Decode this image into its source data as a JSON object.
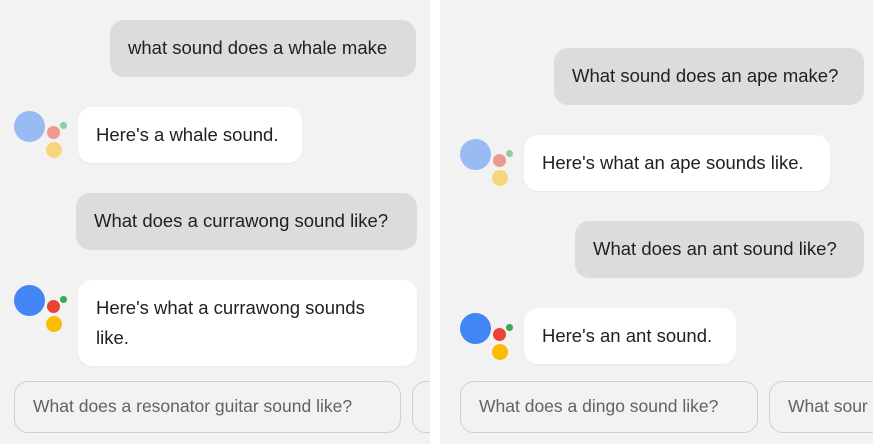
{
  "colors": {
    "assistant_blue": "#4285f4",
    "assistant_red": "#ea4335",
    "assistant_yellow": "#fbbc05",
    "assistant_green": "#34a853",
    "user_bubble": "#dcdcdc",
    "assistant_bubble": "#ffffff"
  },
  "left_panel": {
    "messages": [
      {
        "role": "user",
        "text": "what sound does a whale make"
      },
      {
        "role": "assistant",
        "text": "Here's a whale sound."
      },
      {
        "role": "user",
        "text": "What does a currawong sound like?"
      },
      {
        "role": "assistant",
        "text": "Here's what a currawong sounds like."
      }
    ],
    "suggestions": [
      "What does a resonator guitar sound like?",
      ""
    ]
  },
  "right_panel": {
    "messages": [
      {
        "role": "user",
        "text": "What sound does an ape make?"
      },
      {
        "role": "assistant",
        "text": "Here's what an ape sounds like."
      },
      {
        "role": "user",
        "text": "What does an ant sound like?"
      },
      {
        "role": "assistant",
        "text": "Here's an ant sound."
      }
    ],
    "suggestions": [
      "What does a dingo sound like?",
      "What sour"
    ]
  }
}
